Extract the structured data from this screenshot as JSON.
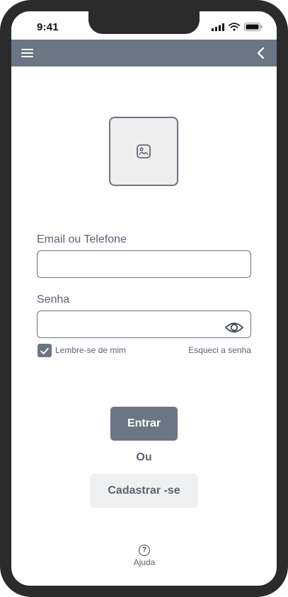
{
  "status_bar": {
    "time": "9:41"
  },
  "app_bar": {
    "menu_icon": "hamburger-menu-icon",
    "back_icon": "chevron-left-icon"
  },
  "logo": {
    "icon": "image-placeholder-icon"
  },
  "form": {
    "email_label": "Email ou Telefone",
    "email_value": "",
    "password_label": "Senha",
    "password_value": "",
    "remember_label": "Lembre-se de mim",
    "remember_checked": true,
    "forgot_label": "Esqueci a senha"
  },
  "actions": {
    "login_label": "Entrar",
    "or_label": "Ou",
    "signup_label": "Cadastrar -se"
  },
  "help": {
    "label": "Ajuda",
    "icon_glyph": "?"
  },
  "colors": {
    "accent": "#6b7583",
    "frame": "#2b2b2b",
    "secondary_bg": "#eef0f2"
  }
}
